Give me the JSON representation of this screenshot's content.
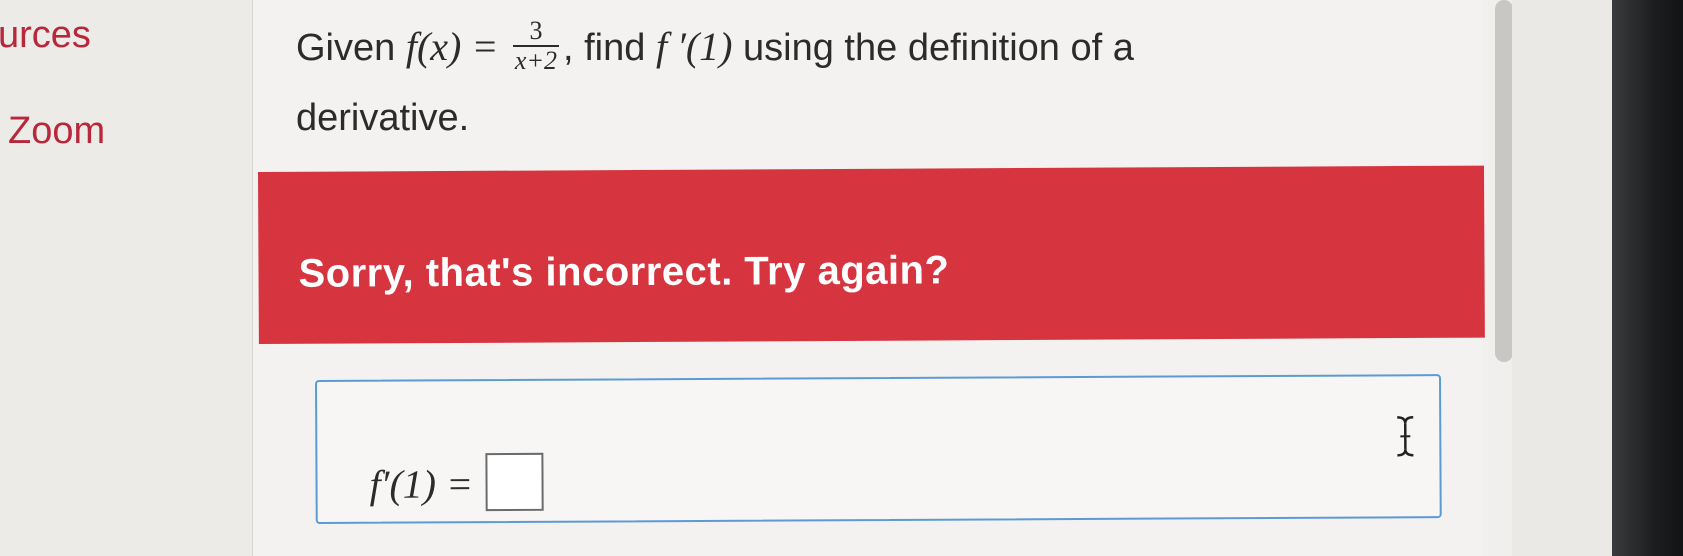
{
  "sidebar": {
    "resources_label": "urces",
    "zoom_label": "Zoom"
  },
  "question": {
    "prefix": "Given",
    "func_lhs": "f(x) =",
    "frac_num": "3",
    "frac_den": "x+2",
    "middle": ", find",
    "target": "f ′(1)",
    "suffix": "using the definition of a",
    "line2": "derivative."
  },
  "feedback": {
    "message": "Sorry, that's incorrect. Try again?"
  },
  "answer": {
    "expression": "f′(1) =",
    "value": ""
  },
  "colors": {
    "accent_red": "#d6343f",
    "link_red": "#b8273a",
    "input_border_blue": "#5b9bd5"
  },
  "icons": {
    "cursor": "text-cursor-icon"
  }
}
